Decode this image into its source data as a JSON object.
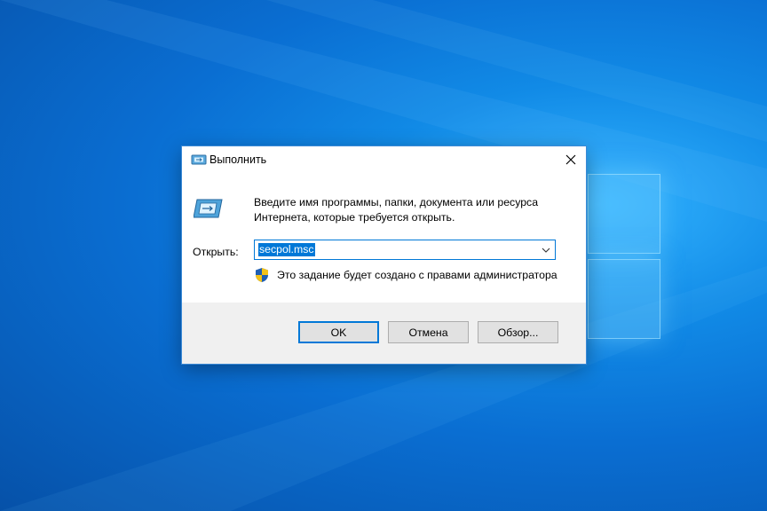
{
  "dialog": {
    "title": "Выполнить",
    "description_line1": "Введите имя программы, папки, документа или ресурса",
    "description_line2": "Интернета, которые требуется открыть.",
    "open_label": "Открыть:",
    "open_value": "secpol.msc",
    "admin_note": "Это задание будет создано с правами администратора",
    "buttons": {
      "ok": "OK",
      "cancel": "Отмена",
      "browse": "Обзор..."
    }
  },
  "colors": {
    "accent": "#0078d7",
    "desktop": "#0a6fcf"
  },
  "icons": [
    "run-icon",
    "close-icon",
    "chevron-down-icon",
    "uac-shield-icon"
  ]
}
